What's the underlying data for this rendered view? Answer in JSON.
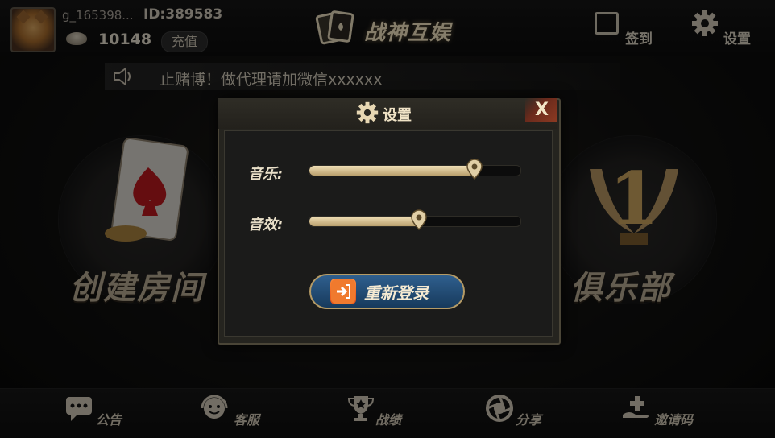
{
  "user": {
    "name": "g_165398...",
    "id": "ID:389583",
    "coins": "10148",
    "recharge_label": "充值"
  },
  "header": {
    "logo_text": "战神互娱",
    "checkin_label": "签到",
    "settings_label": "设置"
  },
  "notice": {
    "text": "止赌博！做代理请加微信xxxxxx"
  },
  "lobby": {
    "create_room_label": "创建房间",
    "club_label": "俱乐部",
    "club_badge": "1"
  },
  "dialog": {
    "title": "设置",
    "close_label": "X",
    "music_label": "音乐:",
    "music_level": 0.78,
    "sfx_label": "音效:",
    "sfx_level": 0.52,
    "relogin_label": "重新登录"
  },
  "bottom_nav": {
    "items": [
      {
        "label": "公告",
        "icon": "notice-icon"
      },
      {
        "label": "客服",
        "icon": "support-icon"
      },
      {
        "label": "战绩",
        "icon": "trophy-icon"
      },
      {
        "label": "分享",
        "icon": "share-icon"
      },
      {
        "label": "邀请码",
        "icon": "invite-icon"
      }
    ]
  },
  "colors": {
    "gold": "#e9dfc8",
    "slider_fill": "#d9c69a",
    "button_blue": "#2f5f8e",
    "close_red": "#8d3a22"
  }
}
